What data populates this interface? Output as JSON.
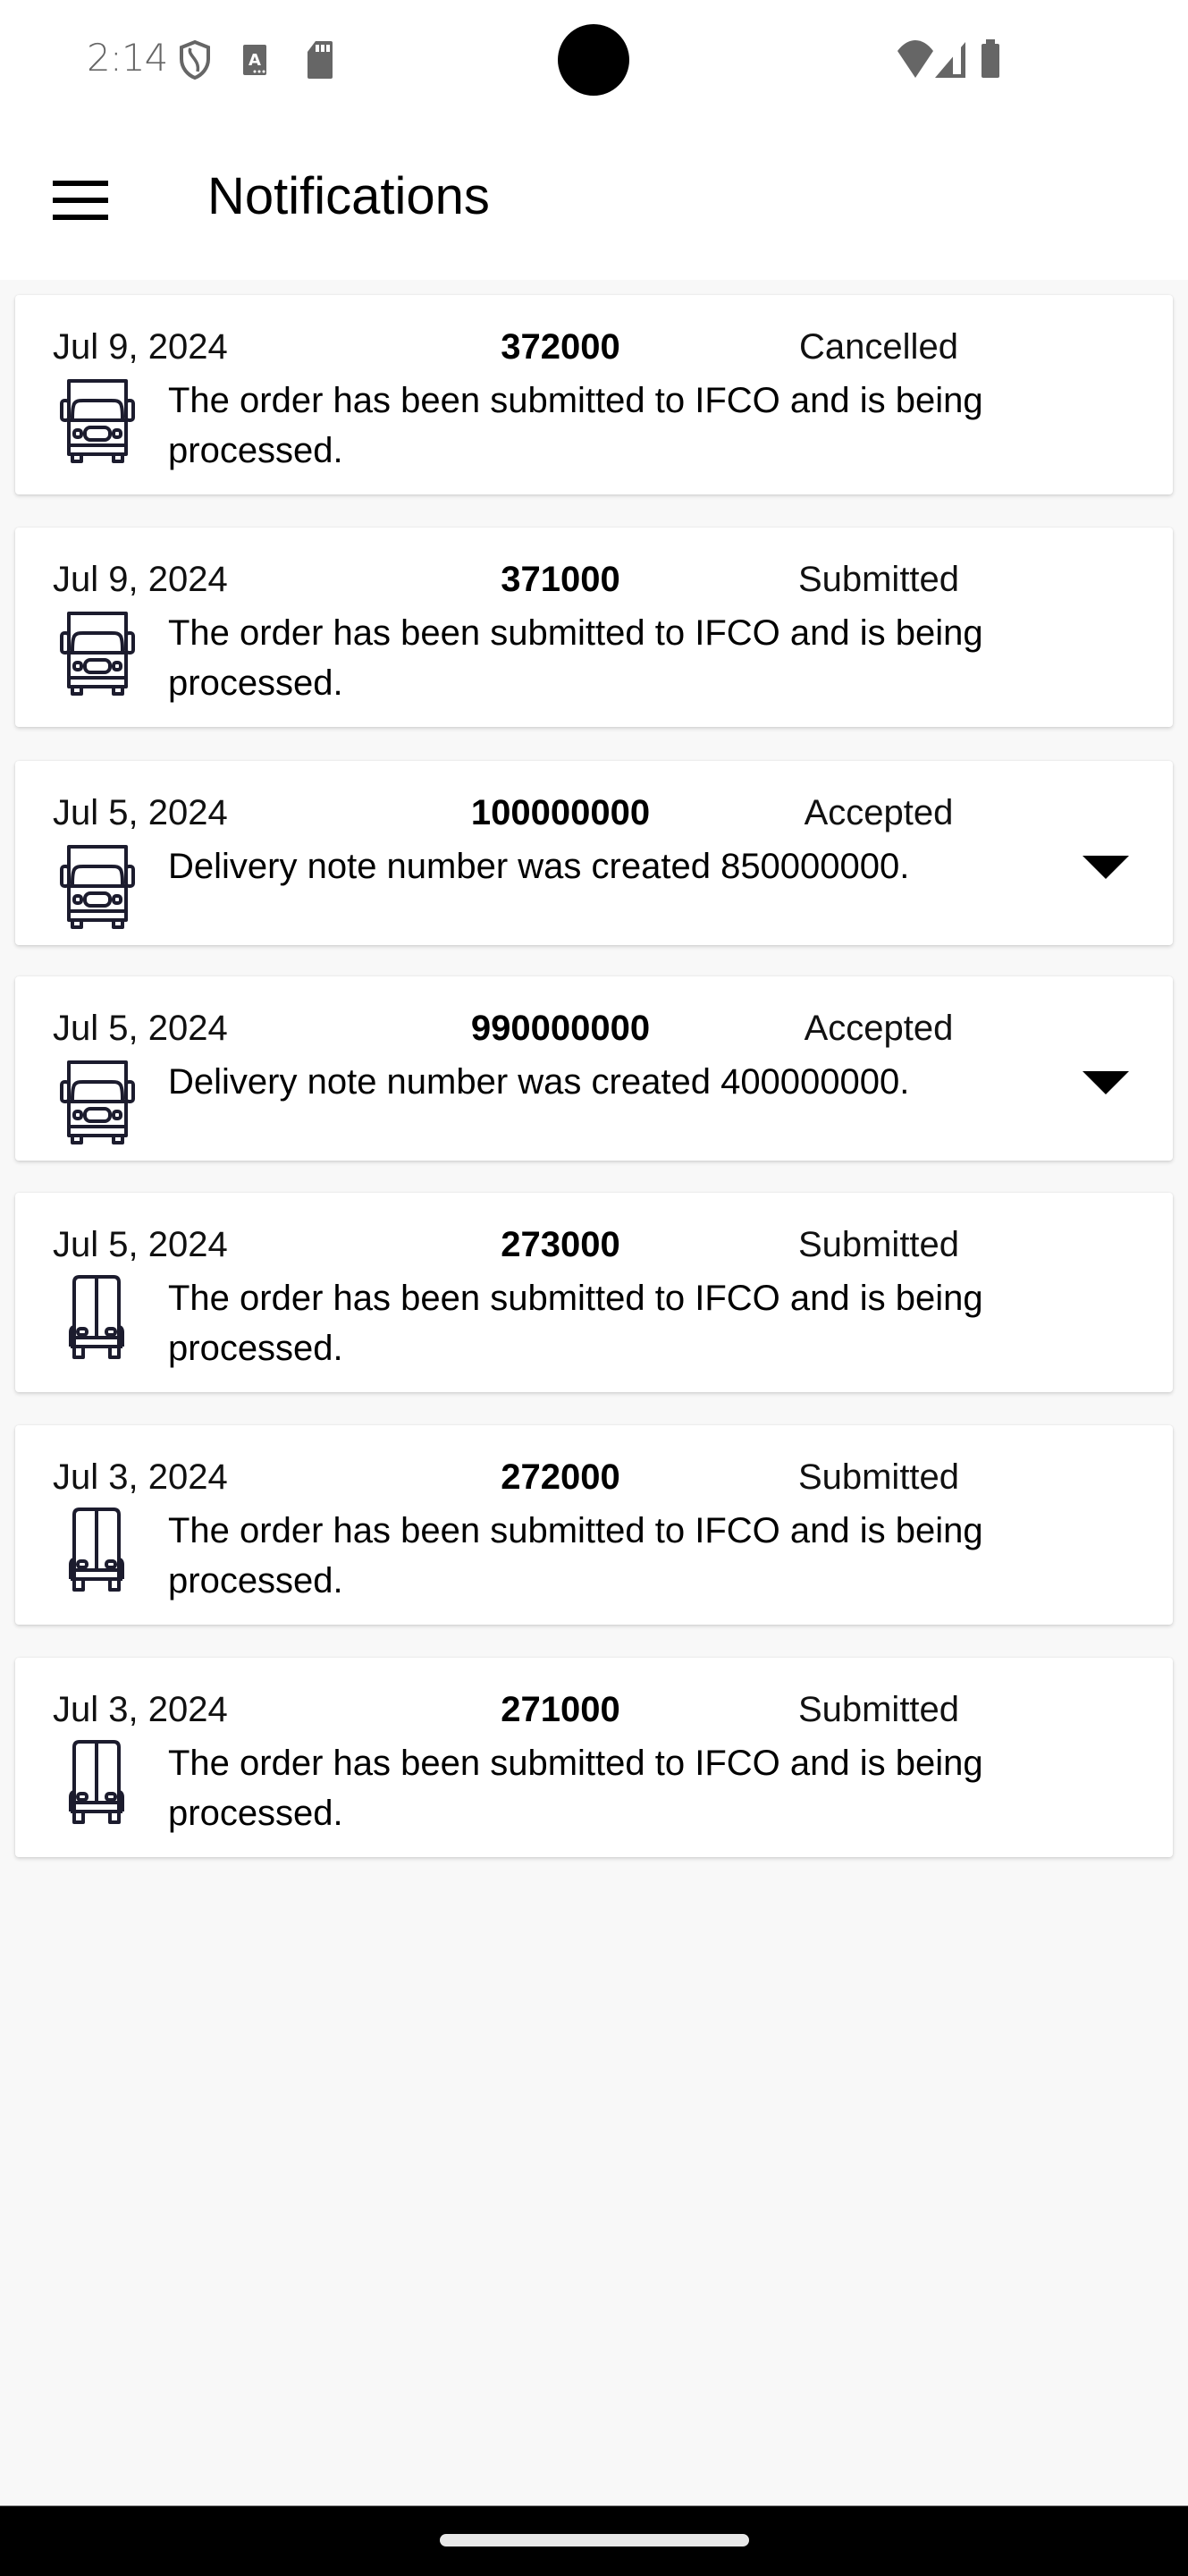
{
  "status_bar": {
    "time": "2:14",
    "left_icons": [
      "shield-icon",
      "accessibility-a-icon",
      "sd-card-icon"
    ],
    "right_icons": [
      "wifi-icon",
      "cellular-signal-icon",
      "battery-icon"
    ]
  },
  "app_bar": {
    "menu_icon": "hamburger-menu-icon",
    "title": "Notifications"
  },
  "notifications": [
    {
      "date": "Jul 9, 2024",
      "number": "372000",
      "status": "Cancelled",
      "message": "The order has been submitted to IFCO and is being processed.",
      "icon": "truck-front-icon",
      "expandable": false
    },
    {
      "date": "Jul 9, 2024",
      "number": "371000",
      "status": "Submitted",
      "message": "The order has been submitted to IFCO and is being processed.",
      "icon": "truck-front-icon",
      "expandable": false
    },
    {
      "date": "Jul 5, 2024",
      "number": "100000000",
      "status": "Accepted",
      "message": "Delivery note number was created 850000000.",
      "icon": "truck-front-icon",
      "expandable": true
    },
    {
      "date": "Jul 5, 2024",
      "number": "990000000",
      "status": "Accepted",
      "message": "Delivery note number was created 400000000.",
      "icon": "truck-front-icon",
      "expandable": true
    },
    {
      "date": "Jul 5, 2024",
      "number": "273000",
      "status": "Submitted",
      "message": "The order has been submitted to IFCO and is being processed.",
      "icon": "truck-rear-icon",
      "expandable": false
    },
    {
      "date": "Jul 3, 2024",
      "number": "272000",
      "status": "Submitted",
      "message": "The order has been submitted to IFCO and is being processed.",
      "icon": "truck-rear-icon",
      "expandable": false
    },
    {
      "date": "Jul 3, 2024",
      "number": "271000",
      "status": "Submitted",
      "message": "The order has been submitted to IFCO and is being processed.",
      "icon": "truck-rear-icon",
      "expandable": false
    }
  ],
  "colors": {
    "background": "#f8f8f8",
    "card": "#ffffff",
    "icon_stroke": "#1c1c2e",
    "status_icons": "#666666"
  }
}
